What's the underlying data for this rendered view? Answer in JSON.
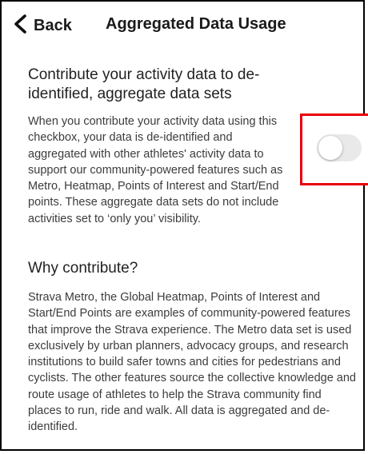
{
  "header": {
    "back_label": "Back",
    "title": "Aggregated Data Usage"
  },
  "contribute": {
    "heading": "Contribute your activity data to de-identified, aggregate data sets",
    "description": "When you contribute your activity data using this checkbox, your data is de-identified and aggregated with other athletes' activity data to support our community-powered features such as Metro, Heatmap, Points of Interest and Start/End points. These aggregate data sets do not include activities set to ‘only you’ visibility.",
    "toggle_on": false
  },
  "why": {
    "heading": "Why contribute?",
    "description": "Strava Metro, the Global Heatmap, Points of Interest and Start/End Points are examples of community-powered features that improve the Strava experience. The Metro data set is used exclusively by urban planners, advocacy groups, and research institutions to build safer towns and cities for pedestrians and cyclists. The other features source the collective knowledge and route usage of athletes to help the Strava community find places to run, ride and walk. All data is aggregated and de-identified."
  },
  "colors": {
    "highlight": "#e8000b",
    "toggle_off": "#e9e9ea"
  },
  "icons": {
    "back": "chevron-left-icon"
  }
}
